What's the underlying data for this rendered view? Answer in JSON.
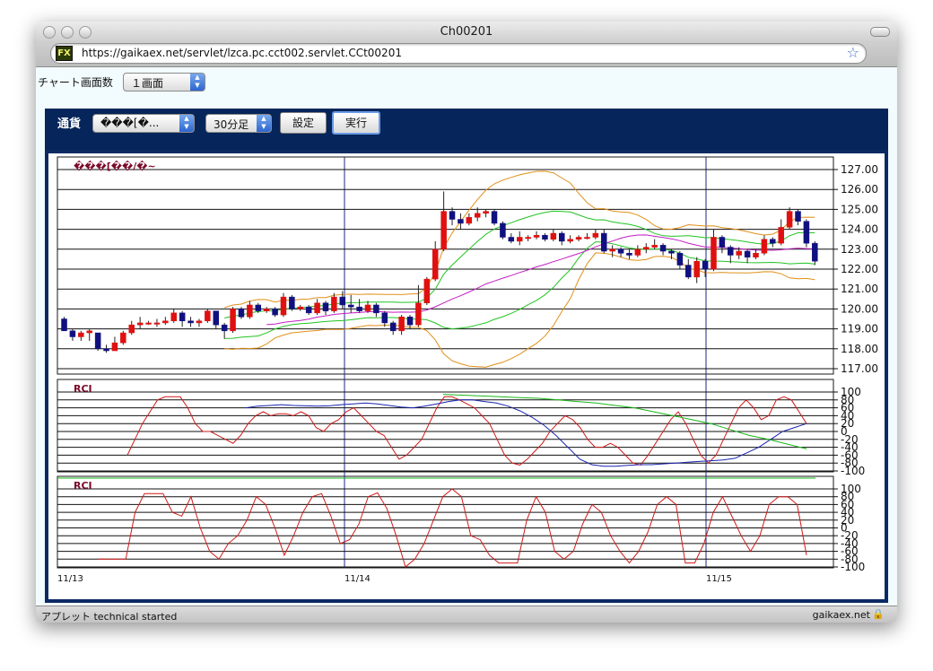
{
  "window": {
    "title": "Ch00201",
    "url": "https://gaikaex.net/servlet/lzca.pc.cct002.servlet.CCt00201",
    "favicon_text": "FX"
  },
  "controls": {
    "chart_count_label": "チャート画面数",
    "chart_count_value": "１画面",
    "currency_label": "通貨",
    "currency_value": "���[�...",
    "interval_value": "30分足",
    "settings_button": "設定",
    "execute_button": "実行"
  },
  "status": {
    "left_text": "アプレット technical started",
    "right_text": "gaikaex.net"
  },
  "chart_data": [
    {
      "type": "candlestick",
      "title": "���[��/�~",
      "ylim": [
        117,
        127
      ],
      "yticks": [
        "127.00",
        "126.00",
        "125.00",
        "124.00",
        "123.00",
        "122.00",
        "121.00",
        "120.00",
        "119.00",
        "118.00",
        "117.00"
      ],
      "x_labels": [
        "11/13",
        "11/14",
        "11/15"
      ],
      "bollinger_bands": true,
      "moving_averages": true,
      "candles": [
        [
          119.5,
          118.9,
          119.6,
          118.9
        ],
        [
          118.9,
          118.6,
          119.0,
          118.4
        ],
        [
          118.6,
          118.8,
          118.9,
          118.4
        ],
        [
          118.8,
          118.9,
          119.0,
          118.4
        ],
        [
          118.8,
          118.0,
          118.8,
          117.9
        ],
        [
          118.0,
          117.9,
          118.2,
          117.8
        ],
        [
          117.9,
          118.3,
          118.6,
          117.9
        ],
        [
          118.3,
          118.8,
          118.9,
          118.2
        ],
        [
          118.8,
          119.2,
          119.4,
          118.7
        ],
        [
          119.2,
          119.3,
          119.6,
          119.0
        ],
        [
          119.3,
          119.3,
          119.4,
          119.2
        ],
        [
          119.3,
          119.3,
          119.5,
          119.1
        ],
        [
          119.3,
          119.4,
          119.6,
          119.2
        ],
        [
          119.4,
          119.8,
          120.0,
          119.3
        ],
        [
          119.8,
          119.4,
          119.9,
          119.1
        ],
        [
          119.4,
          119.3,
          119.6,
          119.1
        ],
        [
          119.3,
          119.4,
          119.5,
          119.1
        ],
        [
          119.4,
          119.9,
          120.0,
          119.3
        ],
        [
          119.9,
          119.2,
          119.9,
          119.0
        ],
        [
          119.2,
          118.9,
          119.3,
          118.5
        ],
        [
          118.9,
          120.0,
          120.1,
          118.8
        ],
        [
          120.0,
          119.6,
          120.1,
          119.5
        ],
        [
          119.6,
          120.2,
          120.4,
          119.5
        ],
        [
          120.2,
          119.9,
          120.3,
          119.8
        ],
        [
          119.9,
          120.0,
          120.1,
          119.8
        ],
        [
          120.0,
          119.7,
          120.1,
          119.6
        ],
        [
          119.7,
          120.6,
          120.8,
          119.6
        ],
        [
          120.6,
          120.0,
          120.7,
          119.9
        ],
        [
          120.0,
          120.1,
          120.2,
          119.9
        ],
        [
          120.1,
          119.8,
          120.2,
          119.7
        ],
        [
          119.8,
          120.3,
          120.5,
          119.7
        ],
        [
          120.3,
          119.9,
          120.4,
          119.7
        ],
        [
          119.9,
          120.6,
          120.8,
          119.8
        ],
        [
          120.6,
          120.2,
          120.9,
          120.0
        ],
        [
          120.2,
          120.1,
          120.7,
          119.8
        ],
        [
          120.1,
          119.9,
          120.5,
          119.8
        ],
        [
          119.9,
          120.2,
          120.4,
          119.8
        ],
        [
          120.2,
          119.8,
          120.3,
          119.6
        ],
        [
          119.8,
          119.3,
          119.9,
          119.1
        ],
        [
          119.3,
          118.9,
          119.4,
          118.7
        ],
        [
          118.9,
          119.6,
          119.7,
          118.7
        ],
        [
          119.6,
          119.2,
          119.7,
          119.0
        ],
        [
          119.2,
          120.3,
          121.2,
          119.1
        ],
        [
          120.3,
          121.5,
          121.6,
          120.2
        ],
        [
          121.5,
          123.0,
          123.4,
          121.4
        ],
        [
          123.0,
          124.9,
          125.9,
          122.9
        ],
        [
          124.9,
          124.5,
          125.1,
          124.2
        ],
        [
          124.5,
          124.3,
          124.8,
          124.0
        ],
        [
          124.3,
          124.6,
          124.8,
          124.2
        ],
        [
          124.6,
          124.8,
          125.1,
          124.4
        ],
        [
          124.8,
          124.9,
          125.0,
          124.6
        ],
        [
          124.9,
          124.3,
          125.0,
          124.2
        ],
        [
          124.3,
          123.6,
          124.4,
          123.5
        ],
        [
          123.6,
          123.4,
          123.8,
          123.3
        ],
        [
          123.4,
          123.6,
          123.9,
          123.2
        ],
        [
          123.6,
          123.6,
          123.7,
          123.4
        ],
        [
          123.6,
          123.7,
          123.9,
          123.5
        ],
        [
          123.7,
          123.5,
          123.8,
          123.4
        ],
        [
          123.5,
          123.8,
          124.0,
          123.4
        ],
        [
          123.8,
          123.4,
          123.9,
          123.2
        ],
        [
          123.4,
          123.5,
          123.7,
          123.3
        ],
        [
          123.5,
          123.6,
          123.7,
          123.4
        ],
        [
          123.6,
          123.6,
          123.8,
          123.5
        ],
        [
          123.6,
          123.8,
          124.0,
          123.5
        ],
        [
          123.8,
          122.9,
          124.0,
          122.8
        ],
        [
          122.9,
          123.0,
          123.2,
          122.6
        ],
        [
          123.0,
          122.8,
          123.1,
          122.6
        ],
        [
          122.8,
          122.7,
          123.0,
          122.5
        ],
        [
          122.7,
          123.0,
          123.2,
          122.6
        ],
        [
          123.0,
          123.1,
          123.3,
          122.8
        ],
        [
          123.1,
          123.2,
          123.5,
          123.0
        ],
        [
          123.2,
          122.9,
          123.3,
          122.7
        ],
        [
          122.9,
          122.8,
          123.0,
          122.5
        ],
        [
          122.8,
          122.2,
          122.9,
          122.0
        ],
        [
          122.2,
          121.6,
          122.5,
          121.5
        ],
        [
          121.6,
          122.4,
          122.6,
          121.3
        ],
        [
          122.4,
          122.0,
          122.5,
          121.6
        ],
        [
          122.0,
          123.6,
          124.0,
          121.9
        ],
        [
          123.6,
          123.1,
          123.7,
          122.8
        ],
        [
          123.1,
          122.7,
          123.2,
          122.3
        ],
        [
          122.7,
          122.9,
          123.1,
          122.5
        ],
        [
          122.9,
          122.6,
          123.0,
          122.3
        ],
        [
          122.6,
          122.8,
          123.0,
          122.5
        ],
        [
          122.8,
          123.5,
          123.7,
          122.7
        ],
        [
          123.5,
          123.3,
          123.6,
          123.1
        ],
        [
          123.3,
          124.1,
          124.5,
          123.2
        ],
        [
          124.1,
          124.9,
          125.1,
          124.0
        ],
        [
          124.9,
          124.4,
          125.0,
          124.2
        ],
        [
          124.4,
          123.3,
          124.5,
          123.1
        ],
        [
          123.3,
          122.4,
          123.4,
          122.2
        ]
      ]
    },
    {
      "type": "line",
      "title": "RCI",
      "ylim": [
        -100,
        100
      ],
      "yticks": [
        "100",
        "80",
        "60",
        "40",
        "20",
        "0",
        "-20",
        "-40",
        "-60",
        "-80",
        "-100"
      ],
      "series": [
        {
          "color": "#d01818",
          "values": [
            -60,
            -20,
            20,
            50,
            80,
            88,
            88,
            88,
            60,
            20,
            0,
            0,
            -10,
            -20,
            -30,
            -10,
            20,
            40,
            50,
            40,
            45,
            45,
            40,
            50,
            40,
            10,
            0,
            20,
            30,
            50,
            60,
            40,
            20,
            0,
            -10,
            -40,
            -70,
            -60,
            -40,
            -20,
            20,
            60,
            88,
            88,
            80,
            70,
            60,
            40,
            20,
            -20,
            -60,
            -80,
            -85,
            -70,
            -50,
            -30,
            0,
            20,
            40,
            30,
            10,
            -20,
            -40,
            -40,
            -30,
            -40,
            -60,
            -80,
            -85,
            -60,
            -30,
            0,
            30,
            50,
            20,
            -20,
            -60,
            -80,
            -60,
            -20,
            20,
            60,
            80,
            60,
            30,
            40,
            80,
            88,
            80,
            50,
            20
          ]
        },
        {
          "color": "#1a24b0",
          "values": [
            60,
            64,
            66,
            68,
            66,
            65,
            64,
            65,
            68,
            70,
            72,
            70,
            66,
            62,
            60,
            64,
            70,
            76,
            80,
            80,
            76,
            72,
            64,
            52,
            36,
            16,
            -10,
            -40,
            -70,
            -84,
            -88,
            -88,
            -86,
            -84,
            -84,
            -82,
            -80,
            -78,
            -76,
            -74,
            -72,
            -68,
            -54,
            -40,
            -20,
            0,
            10,
            20
          ]
        },
        {
          "color": "#18b818",
          "values": [
            94,
            92,
            90,
            88,
            86,
            84,
            80,
            76,
            72,
            66,
            60,
            50,
            40,
            30,
            20,
            5,
            -10,
            -20,
            -32,
            -44
          ]
        }
      ]
    },
    {
      "type": "line",
      "title": "RCI",
      "ylim": [
        -100,
        100
      ],
      "yticks": [
        "100",
        "80",
        "60",
        "40",
        "20",
        "0",
        "-20",
        "-40",
        "-60",
        "-80",
        "-100"
      ],
      "series": [
        {
          "color": "#d01818",
          "values": [
            -80,
            -80,
            -80,
            -80,
            40,
            88,
            88,
            88,
            40,
            30,
            80,
            0,
            -60,
            -80,
            -40,
            -20,
            20,
            80,
            60,
            0,
            -70,
            -20,
            40,
            80,
            88,
            30,
            -40,
            -30,
            10,
            80,
            90,
            50,
            -20,
            -100,
            -80,
            -40,
            20,
            80,
            100,
            80,
            -20,
            -30,
            -70,
            -90,
            -90,
            -90,
            20,
            80,
            40,
            -60,
            -80,
            -60,
            10,
            60,
            40,
            -20,
            -60,
            -90,
            -60,
            -10,
            60,
            80,
            60,
            -90,
            -90,
            -40,
            40,
            80,
            30,
            -20,
            -60,
            -20,
            60,
            80,
            80,
            60,
            -70
          ]
        }
      ]
    }
  ]
}
